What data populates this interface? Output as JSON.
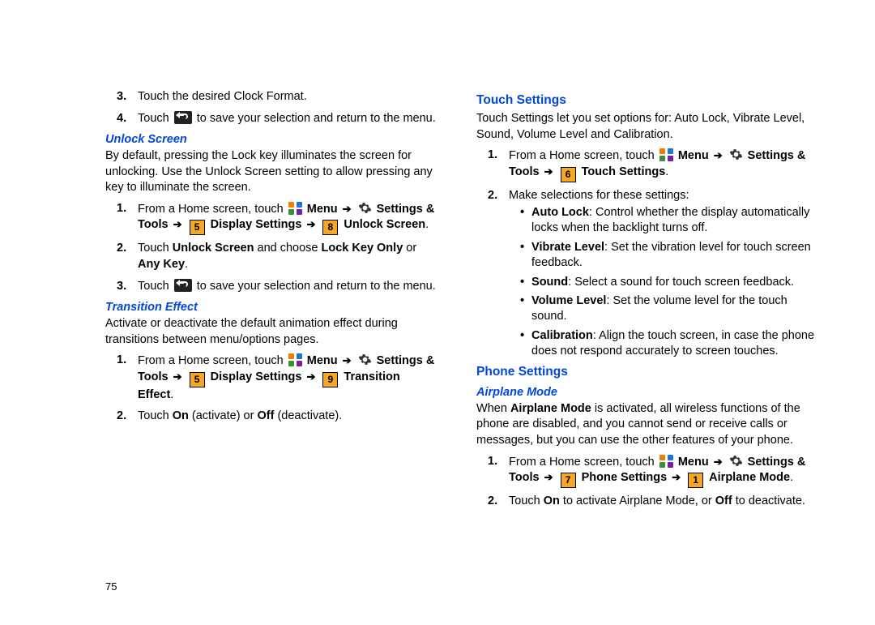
{
  "page_number": "75",
  "arrow": "➔",
  "left": {
    "step3": "Touch the desired Clock Format.",
    "step4_a": "Touch ",
    "step4_b": " to save your selection and return to the menu.",
    "unlock_screen_h": "Unlock Screen",
    "unlock_intro": "By default, pressing the Lock key illuminates the screen for unlocking. Use the Unlock Screen setting to allow pressing any key to illuminate the screen.",
    "us1_a": "From a Home screen, touch ",
    "menu_label": "Menu",
    "settings_tools_label": "Settings & Tools",
    "display_settings": "Display Settings",
    "unlock_screen": "Unlock Screen",
    "us2_a": "Touch ",
    "us2_b": "Unlock Screen",
    "us2_c": " and choose ",
    "us2_d": "Lock Key Only",
    "us2_e": " or ",
    "us2_f": "Any Key",
    "us3_a": "Touch ",
    "us3_b": " to save your selection and return to the menu.",
    "transition_h": "Transition Effect",
    "transition_intro": "Activate or deactivate the default animation effect during transitions between menu/options pages.",
    "te1_a": "From a Home screen, touch ",
    "transition_effect": "Transition Effect",
    "te2": "Touch ",
    "te2_on": "On",
    "te2_b": " (activate) or ",
    "te2_off": "Off",
    "te2_c": " (deactivate).",
    "numbox_5": "5",
    "numbox_8": "8",
    "numbox_9": "9"
  },
  "right": {
    "touch_settings_h": "Touch Settings",
    "ts_intro": "Touch Settings let you set options for: Auto Lock, Vibrate Level, Sound, Volume Level and Calibration.",
    "ts1_a": "From a Home screen, touch ",
    "touch_settings": "Touch Settings",
    "ts2": "Make selections for these settings:",
    "b1_label": "Auto Lock",
    "b1_text": ": Control whether the display automatically locks when the backlight turns off.",
    "b2_label": "Vibrate Level",
    "b2_text": ": Set the vibration level for touch screen feedback.",
    "b3_label": "Sound",
    "b3_text": ": Select a sound for touch screen feedback.",
    "b4_label": "Volume Level",
    "b4_text": ": Set the volume level for the touch sound.",
    "b5_label": "Calibration",
    "b5_text": ": Align the touch screen, in case the phone does not respond accurately to screen touches.",
    "phone_settings_h": "Phone Settings",
    "airplane_h": "Airplane Mode",
    "airplane_intro_a": "When ",
    "airplane_intro_b": "Airplane Mode",
    "airplane_intro_c": " is activated, all wireless functions of the phone are disabled, and you cannot send or receive calls or messages, but you can use the other features of your phone.",
    "ap1_a": "From a Home screen, touch ",
    "phone_settings": "Phone Settings",
    "airplane_mode": "Airplane Mode",
    "ap2_a": "Touch ",
    "ap2_on": "On",
    "ap2_b": " to activate Airplane Mode, or ",
    "ap2_off": "Off",
    "ap2_c": " to deactivate.",
    "numbox_6": "6",
    "numbox_7": "7",
    "numbox_1": "1"
  }
}
